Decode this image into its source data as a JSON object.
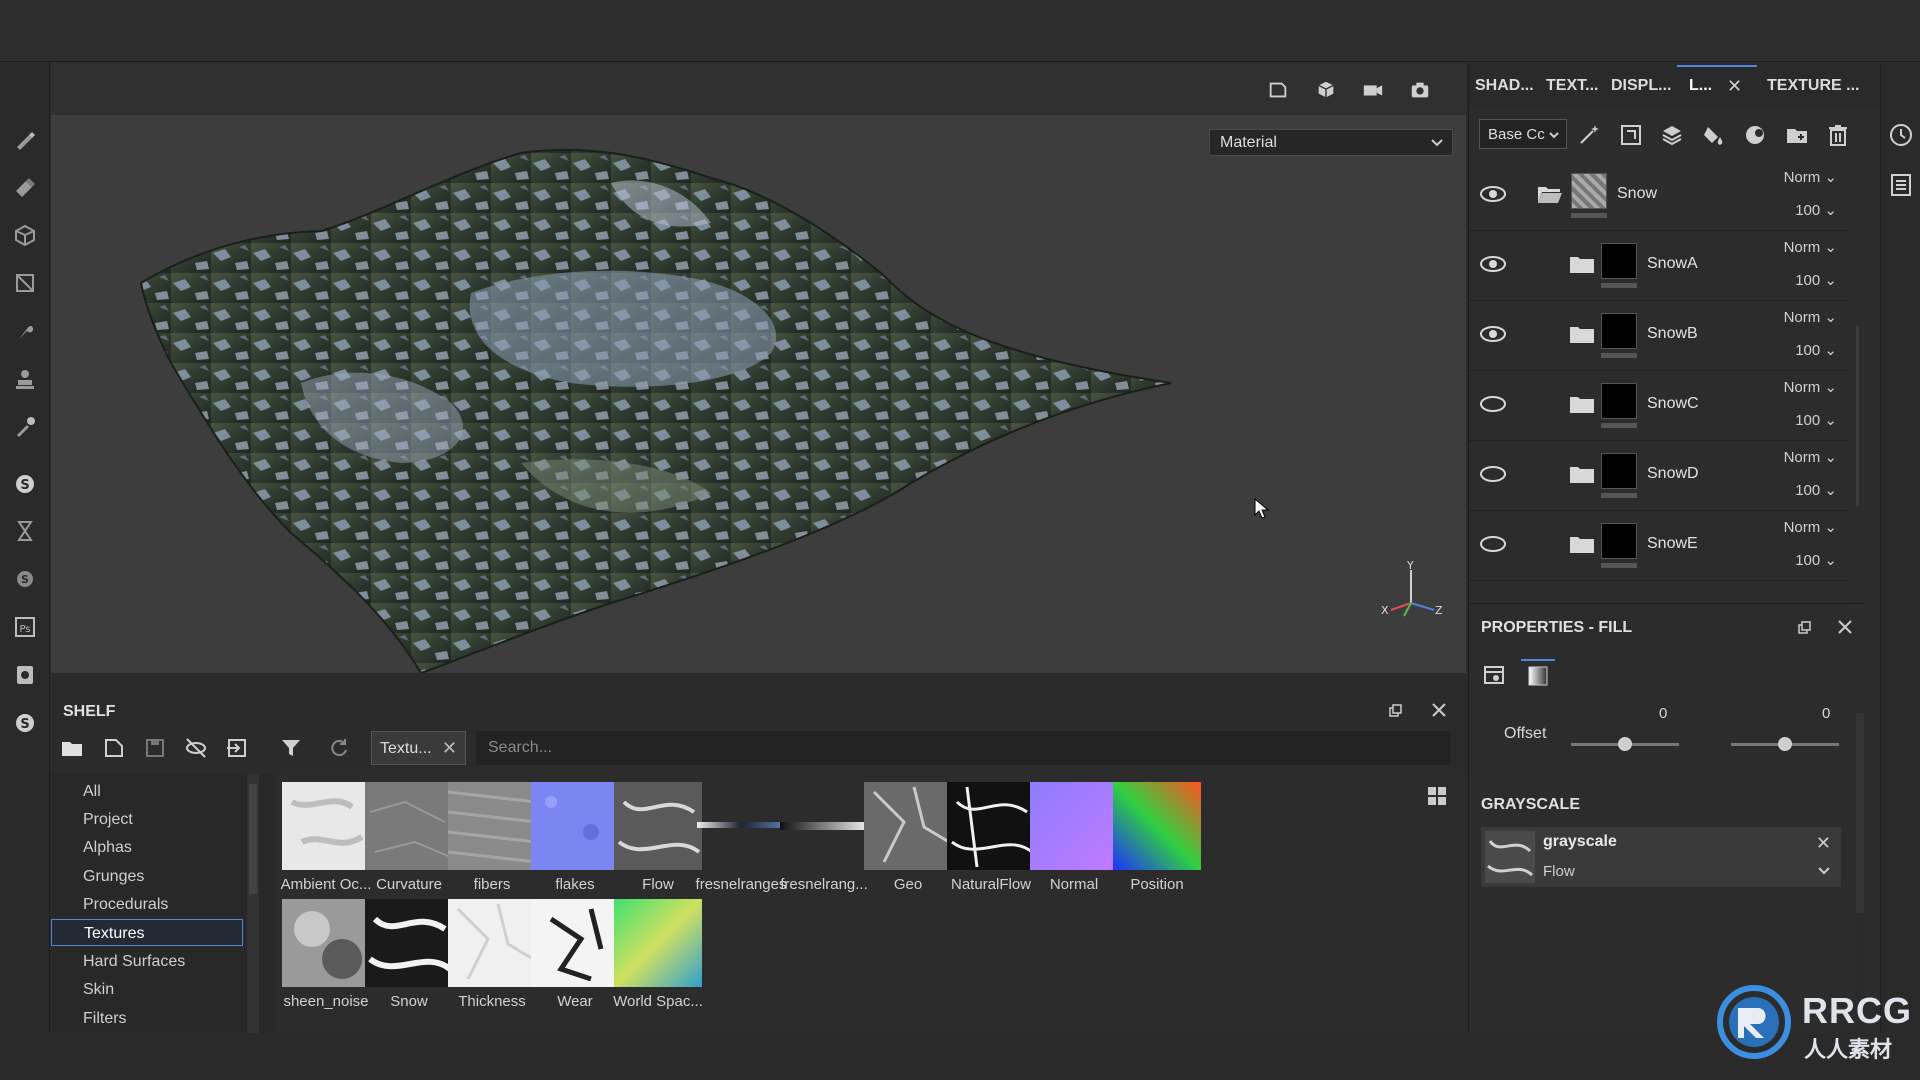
{
  "viewport": {
    "material_mode": "Material"
  },
  "shelf": {
    "title": "SHELF",
    "filter_tag": "Textu...",
    "search_placeholder": "Search...",
    "categories": [
      {
        "label": "All"
      },
      {
        "label": "Project"
      },
      {
        "label": "Alphas"
      },
      {
        "label": "Grunges"
      },
      {
        "label": "Procedurals"
      },
      {
        "label": "Textures",
        "selected": true
      },
      {
        "label": "Hard Surfaces"
      },
      {
        "label": "Skin"
      },
      {
        "label": "Filters"
      }
    ],
    "items": [
      {
        "label": "Ambient Oc..."
      },
      {
        "label": "Curvature"
      },
      {
        "label": "fibers"
      },
      {
        "label": "flakes"
      },
      {
        "label": "Flow"
      },
      {
        "label": "fresnelranges"
      },
      {
        "label": "fresnelrang..."
      },
      {
        "label": "Geo"
      },
      {
        "label": "NaturalFlow"
      },
      {
        "label": "Normal"
      },
      {
        "label": "Position"
      },
      {
        "label": "sheen_noise"
      },
      {
        "label": "Snow"
      },
      {
        "label": "Thickness"
      },
      {
        "label": "Wear"
      },
      {
        "label": "World Spac..."
      }
    ]
  },
  "right_panel": {
    "tabs": [
      {
        "label": "SHAD..."
      },
      {
        "label": "TEXT..."
      },
      {
        "label": "DISPL..."
      },
      {
        "label": "L...",
        "active": true
      },
      {
        "label": "TEXTURE ..."
      }
    ],
    "channel": "Base Cc",
    "layers": [
      {
        "name": "Snow",
        "blend": "Norm",
        "opacity": "100",
        "visible": true,
        "group_open": true
      },
      {
        "name": "SnowA",
        "blend": "Norm",
        "opacity": "100",
        "visible": true
      },
      {
        "name": "SnowB",
        "blend": "Norm",
        "opacity": "100",
        "visible": true
      },
      {
        "name": "SnowC",
        "blend": "Norm",
        "opacity": "100",
        "visible": false
      },
      {
        "name": "SnowD",
        "blend": "Norm",
        "opacity": "100",
        "visible": false
      },
      {
        "name": "SnowE",
        "blend": "Norm",
        "opacity": "100",
        "visible": false
      }
    ],
    "properties": {
      "title": "PROPERTIES - FILL",
      "offset_label": "Offset",
      "offset_u": "0",
      "offset_v": "0",
      "offset_u_fraction": 0.5,
      "offset_v_fraction": 0.5,
      "grayscale_title": "GRAYSCALE",
      "grayscale_name": "grayscale",
      "grayscale_source": "Flow"
    }
  },
  "watermark": {
    "text": "RRCG",
    "subtext": "人人素材"
  },
  "colors": {
    "accent": "#4f88d6",
    "panel_bg": "#2c2c2c",
    "viewport_bg": "#3d3d3d"
  }
}
